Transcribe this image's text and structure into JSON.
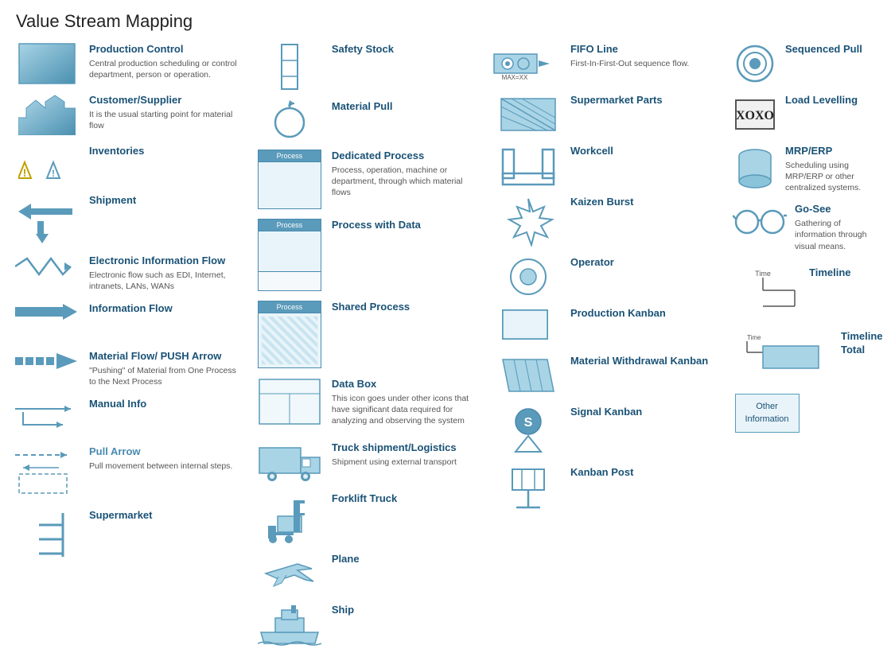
{
  "title": "Value Stream Mapping",
  "columns": [
    {
      "items": [
        {
          "id": "production-control",
          "title": "Production Control",
          "desc": "Central production scheduling or control department, person or operation.",
          "icon": "production-control"
        },
        {
          "id": "customer-supplier",
          "title": "Customer/Supplier",
          "desc": "It is the usual starting point for material flow",
          "icon": "customer-supplier"
        },
        {
          "id": "inventories",
          "title": "Inventories",
          "desc": "",
          "icon": "inventories"
        },
        {
          "id": "shipment",
          "title": "Shipment",
          "desc": "",
          "icon": "shipment"
        },
        {
          "id": "electronic-info-flow",
          "title": "Electronic Information Flow",
          "desc": "Electronic flow such as EDI, Internet, intranets, LANs, WANs",
          "icon": "electronic-info-flow"
        },
        {
          "id": "information-flow",
          "title": "Information Flow",
          "desc": "",
          "icon": "information-flow"
        },
        {
          "id": "material-flow-push",
          "title": "Material Flow/ PUSH Arrow",
          "desc": "\"Pushing\" of Material from One Process to the Next Process",
          "icon": "material-flow-push"
        },
        {
          "id": "manual-info",
          "title": "Manual Info",
          "desc": "",
          "icon": "manual-info"
        },
        {
          "id": "pull-arrow",
          "title": "Pull Arrow",
          "desc": "Pull movement between internal steps.",
          "icon": "pull-arrow"
        },
        {
          "id": "supermarket",
          "title": "Supermarket",
          "desc": "",
          "icon": "supermarket"
        }
      ]
    },
    {
      "items": [
        {
          "id": "safety-stock",
          "title": "Safety Stock",
          "desc": "",
          "icon": "safety-stock"
        },
        {
          "id": "material-pull",
          "title": "Material Pull",
          "desc": "",
          "icon": "material-pull"
        },
        {
          "id": "dedicated-process",
          "title": "Dedicated Process",
          "desc": "Process, operation, machine or department, through which material flows",
          "icon": "dedicated-process"
        },
        {
          "id": "process-with-data",
          "title": "Process with Data",
          "desc": "",
          "icon": "process-with-data"
        },
        {
          "id": "shared-process",
          "title": "Shared Process",
          "desc": "",
          "icon": "shared-process"
        },
        {
          "id": "data-box",
          "title": "Data Box",
          "desc": "This icon goes under other icons that have significant data required for analyzing and observing the system",
          "icon": "data-box"
        },
        {
          "id": "truck-shipment",
          "title": "Truck shipment/Logistics",
          "desc": "Shipment using external transport",
          "icon": "truck-shipment"
        },
        {
          "id": "forklift-truck",
          "title": "Forklift Truck",
          "desc": "",
          "icon": "forklift-truck"
        },
        {
          "id": "plane",
          "title": "Plane",
          "desc": "",
          "icon": "plane"
        },
        {
          "id": "ship",
          "title": "Ship",
          "desc": "",
          "icon": "ship"
        }
      ]
    },
    {
      "items": [
        {
          "id": "fifo-line",
          "title": "FIFO Line",
          "desc": "First-In-First-Out sequence flow.",
          "icon": "fifo-line"
        },
        {
          "id": "supermarket-parts",
          "title": "Supermarket Parts",
          "desc": "",
          "icon": "supermarket-parts"
        },
        {
          "id": "workcell",
          "title": "Workcell",
          "desc": "",
          "icon": "workcell"
        },
        {
          "id": "kaizen-burst",
          "title": "Kaizen Burst",
          "desc": "",
          "icon": "kaizen-burst"
        },
        {
          "id": "operator",
          "title": "Operator",
          "desc": "",
          "icon": "operator"
        },
        {
          "id": "production-kanban",
          "title": "Production Kanban",
          "desc": "",
          "icon": "production-kanban"
        },
        {
          "id": "material-withdrawal-kanban",
          "title": "Material Withdrawal Kanban",
          "desc": "",
          "icon": "material-withdrawal-kanban"
        },
        {
          "id": "signal-kanban",
          "title": "Signal Kanban",
          "desc": "",
          "icon": "signal-kanban"
        },
        {
          "id": "kanban-post",
          "title": "Kanban Post",
          "desc": "",
          "icon": "kanban-post"
        }
      ]
    },
    {
      "items": [
        {
          "id": "sequenced-pull",
          "title": "Sequenced Pull",
          "desc": "",
          "icon": "sequenced-pull"
        },
        {
          "id": "load-levelling",
          "title": "Load Levelling",
          "desc": "",
          "icon": "load-levelling"
        },
        {
          "id": "mrp-erp",
          "title": "MRP/ERP",
          "desc": "Scheduling using MRP/ERP or other centralized systems.",
          "icon": "mrp-erp"
        },
        {
          "id": "go-see",
          "title": "Go-See",
          "desc": "Gathering of information through visual means.",
          "icon": "go-see"
        },
        {
          "id": "timeline",
          "title": "Timeline",
          "desc": "",
          "icon": "timeline"
        },
        {
          "id": "timeline-total",
          "title": "Timeline Total",
          "desc": "",
          "icon": "timeline-total"
        },
        {
          "id": "other-information",
          "title": "Other Information",
          "desc": "",
          "icon": "other-information"
        }
      ]
    }
  ]
}
